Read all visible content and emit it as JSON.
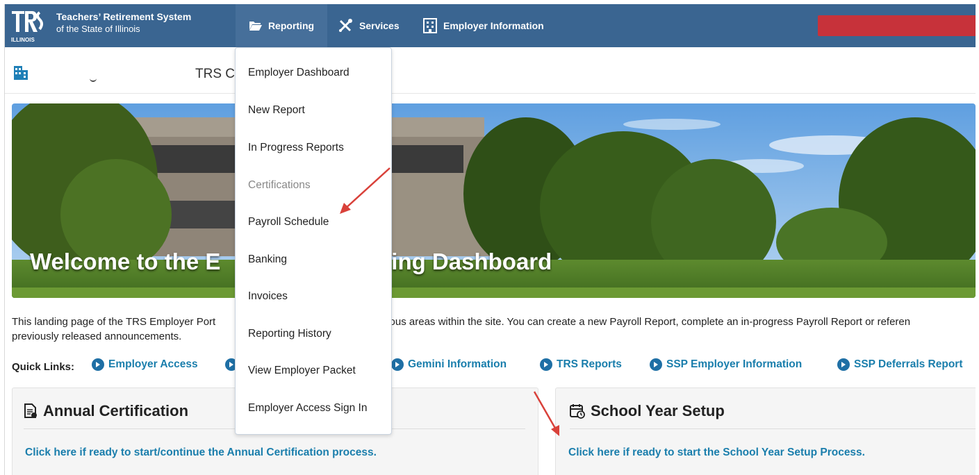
{
  "brand": {
    "line1": "Teachers’ Retirement System",
    "line2": "of the State of Illinois",
    "logo_text": "TRS",
    "logo_sub": "ILLINOIS"
  },
  "nav": [
    {
      "label": "Reporting",
      "icon": "folder-open-icon",
      "active": true
    },
    {
      "label": "Services",
      "icon": "tools-icon",
      "active": false
    },
    {
      "label": "Employer Information",
      "icon": "building-icon",
      "active": false
    }
  ],
  "page": {
    "title_partial": "TRS C"
  },
  "hero": {
    "welcome_left": "Welcome to the E",
    "welcome_right": "rting Dashboard"
  },
  "intro": {
    "part1": "This landing page of the TRS Employer Port",
    "part2": "rious areas within the site. You can create a new Payroll Report, complete an in-progress Payroll Report or referen",
    "line2": "previously released announcements."
  },
  "quick_links": {
    "label": "Quick Links:",
    "items": [
      "Employer Access",
      "Gemini Information",
      "TRS Reports",
      "SSP Employer Information",
      "SSP Deferrals Report"
    ]
  },
  "cards": {
    "annual": {
      "title": "Annual Certification",
      "link": "Click here if ready to start/continue the Annual Certification process."
    },
    "school": {
      "title": "School Year Setup",
      "link": "Click here if ready to start the School Year Setup Process."
    }
  },
  "dropdown": {
    "items": [
      {
        "label": "Employer Dashboard",
        "disabled": false
      },
      {
        "label": "New Report",
        "disabled": false
      },
      {
        "label": "In Progress Reports",
        "disabled": false
      },
      {
        "label": "Certifications",
        "disabled": true
      },
      {
        "label": "Payroll Schedule",
        "disabled": false
      },
      {
        "label": "Banking",
        "disabled": false
      },
      {
        "label": "Invoices",
        "disabled": false
      },
      {
        "label": "Reporting History",
        "disabled": false
      },
      {
        "label": "View Employer Packet",
        "disabled": false
      },
      {
        "label": "Employer Access Sign In",
        "disabled": false
      }
    ]
  },
  "colors": {
    "nav_bg": "#3a6591",
    "link": "#1a7eac",
    "quick_dot": "#1e6fa5",
    "annotation_arrow": "#d9413a",
    "redacted": "#c7323a"
  }
}
